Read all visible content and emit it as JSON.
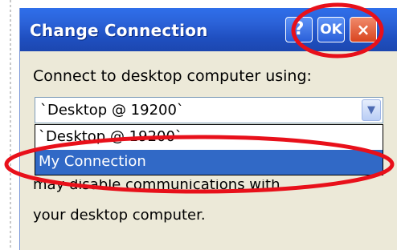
{
  "dialog": {
    "title": "Change Connection",
    "help_button": "?",
    "ok_button": "OK",
    "close_button": "×"
  },
  "content": {
    "prompt_label": "Connect to desktop computer using:",
    "combo_value": "`Desktop @ 19200`",
    "combo_arrow": "▼",
    "dropdown_options": [
      "`Desktop @ 19200`",
      "My Connection"
    ],
    "selected_option": "My Connection",
    "description_line1": "may disable communications with",
    "description_line2": "your desktop computer."
  },
  "annotation": {
    "color": "#e8101a"
  },
  "colors": {
    "titlebar": "#2b62d8",
    "dialog_bg": "#ece9d8",
    "selection": "#3169c6"
  }
}
